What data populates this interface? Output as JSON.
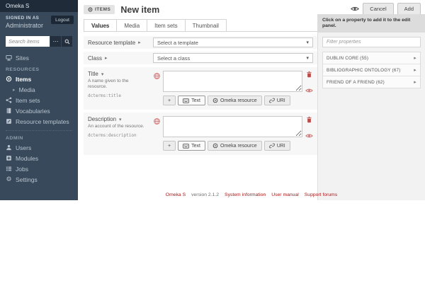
{
  "app": {
    "name": "Omeka S"
  },
  "colors": {
    "accent_red": "#a91919",
    "sidebar_bg": "#37495b",
    "topbar_bg": "#1f2b38",
    "row_bg": "#f7f7f7"
  },
  "sidebar": {
    "logo": "Omeka S",
    "signed_in_label": "SIGNED IN AS",
    "user_name": "Administrator",
    "logout_label": "Logout",
    "search_placeholder": "Search items",
    "sites_label": "Sites",
    "resources_header": "RESOURCES",
    "items_label": "Items",
    "media_label": "Media",
    "item_sets_label": "Item sets",
    "vocabularies_label": "Vocabularies",
    "resource_templates_label": "Resource templates",
    "admin_header": "ADMIN",
    "users_label": "Users",
    "modules_label": "Modules",
    "jobs_label": "Jobs",
    "settings_label": "Settings"
  },
  "header": {
    "badge": "ITEMS",
    "title": "New item",
    "cancel_label": "Cancel",
    "add_label": "Add"
  },
  "tabs": [
    {
      "label": "Values",
      "active": true
    },
    {
      "label": "Media",
      "active": false
    },
    {
      "label": "Item sets",
      "active": false
    },
    {
      "label": "Thumbnail",
      "active": false
    }
  ],
  "form": {
    "resource_template_row": {
      "label": "Resource template",
      "value": "Select a template"
    },
    "class_row": {
      "label": "Class",
      "value": "Select a class"
    },
    "fields": [
      {
        "label": "Title",
        "comment": "A name given to the resource.",
        "term": "dcterms:title",
        "value": ""
      },
      {
        "label": "Description",
        "comment": "An account of the resource.",
        "term": "dcterms:description",
        "value": ""
      }
    ],
    "value_actions": {
      "add": "+",
      "text": "Text",
      "omeka_resource": "Omeka resource",
      "uri": "URI"
    }
  },
  "properties_panel": {
    "instruction": "Click on a property to add it to the edit panel.",
    "filter_placeholder": "Filter properties",
    "vocabularies": [
      {
        "label": "DUBLIN CORE (55)"
      },
      {
        "label": "BIBLIOGRAPHIC ONTOLOGY (67)"
      },
      {
        "label": "FRIEND OF A FRIEND (62)"
      }
    ]
  },
  "footer": {
    "omeka_link": "Omeka S",
    "version": "version 2.1.2",
    "links": [
      "System information",
      "User manual",
      "Support forums"
    ]
  }
}
